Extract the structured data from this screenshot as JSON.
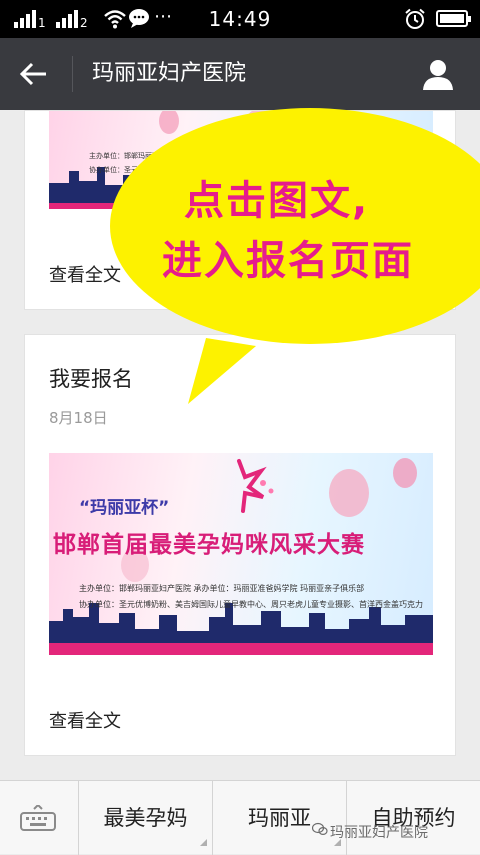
{
  "status_bar": {
    "time": "14:49",
    "icons": [
      "signal-1-icon",
      "signal-2-icon",
      "wifi-icon",
      "message-icon",
      "more-dots-icon",
      "alarm-icon",
      "battery-icon"
    ]
  },
  "header": {
    "title": "玛丽亚妇产医院",
    "background": "#393a3f",
    "icons": [
      "back-arrow-icon",
      "user-profile-icon"
    ]
  },
  "articles": [
    {
      "read_more": "查看全文",
      "banner": {
        "line1": "主办单位：邯郸玛丽亚妇产医院",
        "line2": "协办单位：圣元优博奶粉、"
      }
    },
    {
      "title": "我要报名",
      "date": "8月18日",
      "read_more": "查看全文",
      "banner": {
        "line1": "“玛丽亚杯”",
        "line2": "邯郸首届最美孕妈咪风采大赛",
        "line3": "主办单位：邯郸玛丽亚妇产医院      承办单位：玛丽亚准爸妈学院  玛丽亚亲子俱乐部",
        "line4": "协办单位：圣元优博奶粉、美吉姆国际儿童早教中心、周只老虎儿童专业摄影、首洋西金盖巧克力"
      }
    }
  ],
  "callout": {
    "line1": "点击图文,",
    "line2": "进入报名页面",
    "bubble_color": "#fdf200",
    "text_color": "#e61c8c"
  },
  "bottom_bar": {
    "keyboard_icon": "keyboard-icon",
    "menus": [
      "最美孕妈",
      "玛丽亚",
      "自助预约"
    ],
    "watermark": "玛丽亚妇产医院"
  }
}
